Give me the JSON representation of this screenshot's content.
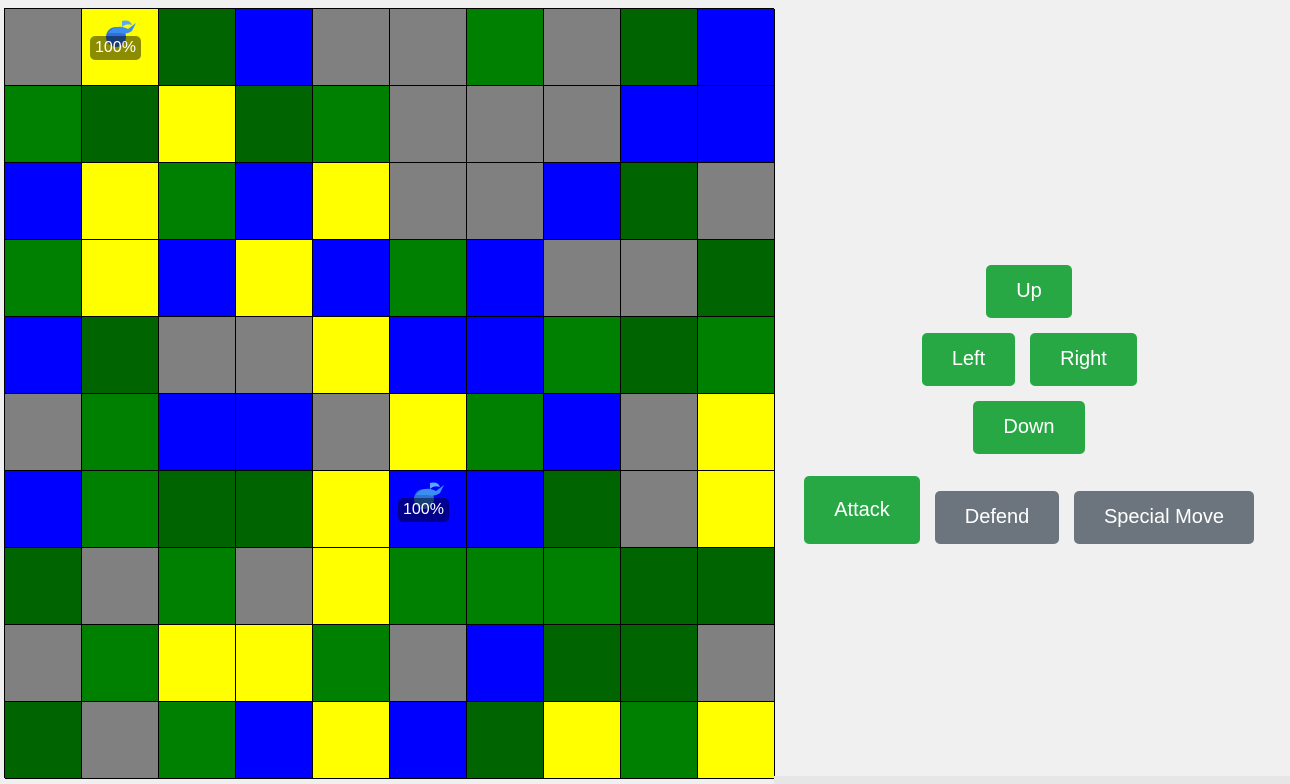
{
  "colors": {
    "G": "#808080",
    "Y": "#ffff00",
    "D": "#006400",
    "B": "#0000ff",
    "L": "#008000"
  },
  "board": [
    [
      "G",
      "Y",
      "D",
      "B",
      "G",
      "G",
      "L",
      "G",
      "D",
      "B"
    ],
    [
      "L",
      "D",
      "Y",
      "D",
      "L",
      "G",
      "G",
      "G",
      "B",
      "B"
    ],
    [
      "B",
      "Y",
      "L",
      "B",
      "Y",
      "G",
      "G",
      "B",
      "D",
      "G"
    ],
    [
      "L",
      "Y",
      "B",
      "Y",
      "B",
      "L",
      "B",
      "G",
      "G",
      "D"
    ],
    [
      "B",
      "D",
      "G",
      "G",
      "Y",
      "B",
      "B",
      "L",
      "D",
      "L"
    ],
    [
      "G",
      "L",
      "B",
      "B",
      "G",
      "Y",
      "L",
      "B",
      "G",
      "Y"
    ],
    [
      "B",
      "L",
      "D",
      "D",
      "Y",
      "B",
      "B",
      "D",
      "G",
      "Y"
    ],
    [
      "D",
      "G",
      "L",
      "G",
      "Y",
      "L",
      "L",
      "L",
      "D",
      "D"
    ],
    [
      "G",
      "L",
      "Y",
      "Y",
      "L",
      "G",
      "B",
      "D",
      "D",
      "G"
    ],
    [
      "D",
      "G",
      "L",
      "B",
      "Y",
      "B",
      "D",
      "Y",
      "L",
      "Y"
    ]
  ],
  "units": [
    {
      "row": 0,
      "col": 1,
      "health": "100%",
      "icon": "dragon-icon"
    },
    {
      "row": 6,
      "col": 5,
      "health": "100%",
      "icon": "dragon-icon"
    }
  ],
  "controls": {
    "up": "Up",
    "left": "Left",
    "right": "Right",
    "down": "Down",
    "attack": "Attack",
    "defend": "Defend",
    "special": "Special Move"
  }
}
